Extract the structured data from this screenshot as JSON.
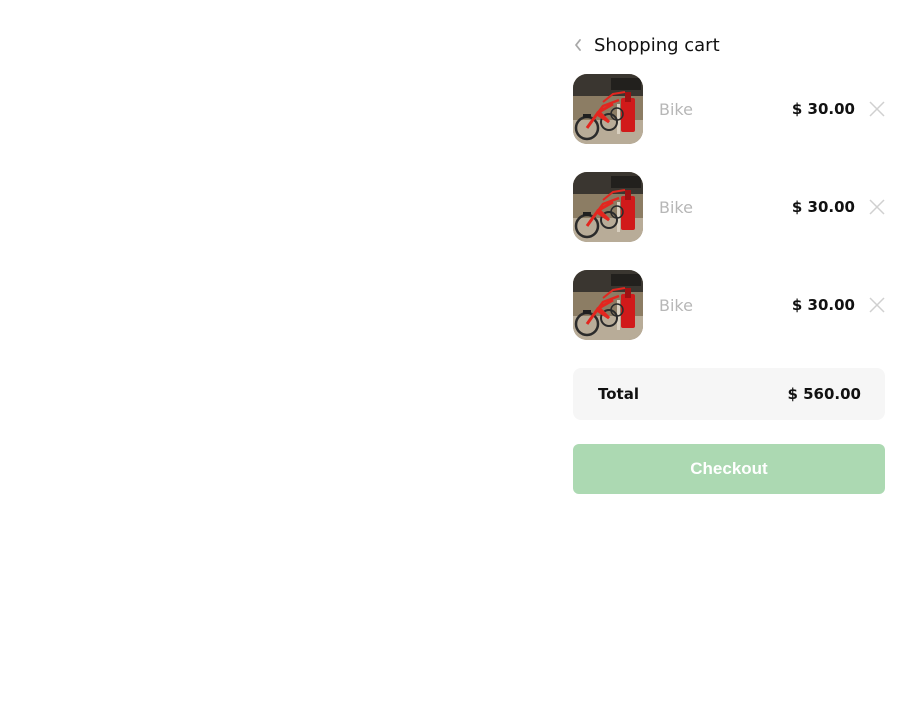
{
  "header": {
    "title": "Shopping cart",
    "back_icon": "chevron-left-icon"
  },
  "items": [
    {
      "name": "Bike",
      "price": "$ 30.00",
      "image": "red-bikes-photo"
    },
    {
      "name": "Bike",
      "price": "$ 30.00",
      "image": "red-bikes-photo"
    },
    {
      "name": "Bike",
      "price": "$ 30.00",
      "image": "red-bikes-photo"
    }
  ],
  "total": {
    "label": "Total",
    "value": "$ 560.00"
  },
  "checkout": {
    "label": "Checkout",
    "color": "#acd9b2"
  },
  "colors": {
    "muted_text": "#b7b7b7",
    "total_bg": "#f6f6f6"
  }
}
